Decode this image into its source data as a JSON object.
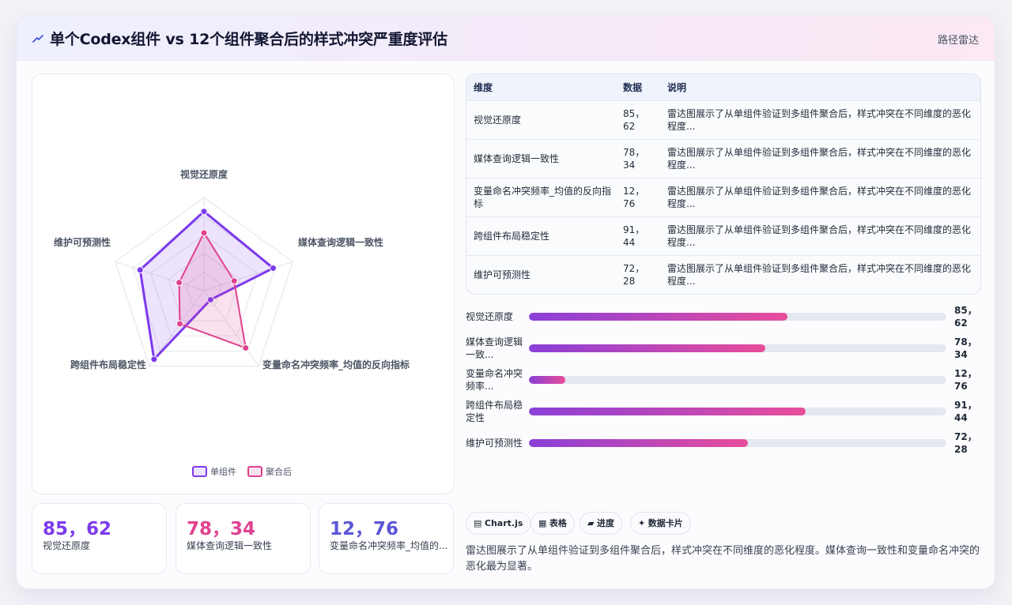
{
  "header": {
    "title": "单个Codex组件 vs 12个组件聚合后的样式冲突严重度评估",
    "right": "路径雷达"
  },
  "table": {
    "columns": [
      "维度",
      "数据",
      "说明"
    ],
    "rows": [
      {
        "dim": "视觉还原度",
        "data": "85，62",
        "note": "雷达图展示了从单组件验证到多组件聚合后，样式冲突在不同维度的恶化程度..."
      },
      {
        "dim": "媒体查询逻辑一致性",
        "data": "78，34",
        "note": "雷达图展示了从单组件验证到多组件聚合后，样式冲突在不同维度的恶化程度..."
      },
      {
        "dim": "变量命名冲突频率_均值的反向指标",
        "data": "12，76",
        "note": "雷达图展示了从单组件验证到多组件聚合后，样式冲突在不同维度的恶化程度..."
      },
      {
        "dim": "跨组件布局稳定性",
        "data": "91，44",
        "note": "雷达图展示了从单组件验证到多组件聚合后，样式冲突在不同维度的恶化程度..."
      },
      {
        "dim": "维护可预测性",
        "data": "72，28",
        "note": "雷达图展示了从单组件验证到多组件聚合后，样式冲突在不同维度的恶化程度..."
      }
    ]
  },
  "progress": [
    {
      "label": "视觉还原度",
      "value_text": "85，62",
      "fill": 0.62
    },
    {
      "label": "媒体查询逻辑一致...",
      "value_text": "78，34",
      "fill": 0.567
    },
    {
      "label": "变量命名冲突频率...",
      "value_text": "12，76",
      "fill": 0.087
    },
    {
      "label": "跨组件布局稳定性",
      "value_text": "91，44",
      "fill": 0.663
    },
    {
      "label": "维护可预测性",
      "value_text": "72，28",
      "fill": 0.524
    }
  ],
  "kpis": [
    {
      "value": "85，62",
      "label": "视觉还原度",
      "color": "#7c3aed"
    },
    {
      "value": "78，34",
      "label": "媒体查询逻辑一致性",
      "color": "#e0428f"
    },
    {
      "value": "12，76",
      "label": "变量命名冲突频率_均值的...",
      "color": "#5b57d6"
    }
  ],
  "chips": [
    {
      "icon": "▤",
      "label": "Chart.js"
    },
    {
      "icon": "▦",
      "label": "表格"
    },
    {
      "icon": "▰",
      "label": "进度"
    },
    {
      "icon": "✦",
      "label": "数据卡片"
    }
  ],
  "description": "雷达图展示了从单组件验证到多组件聚合后，样式冲突在不同维度的恶化程度。媒体查询一致性和变量命名冲突的恶化最为显著。",
  "chart_data": {
    "type": "radar",
    "categories": [
      "视觉还原度",
      "媒体查询逻辑一致性",
      "变量命名冲突频率_均值的反向指标",
      "跨组件布局稳定性",
      "维护可预测性"
    ],
    "series": [
      {
        "name": "单组件",
        "values": [
          85,
          78,
          12,
          91,
          72
        ],
        "color": "#7c3aed"
      },
      {
        "name": "聚合后",
        "values": [
          62,
          34,
          76,
          44,
          28
        ],
        "color": "#e0428f"
      }
    ],
    "rmax": 100,
    "grid": true,
    "legend_position": "bottom"
  }
}
